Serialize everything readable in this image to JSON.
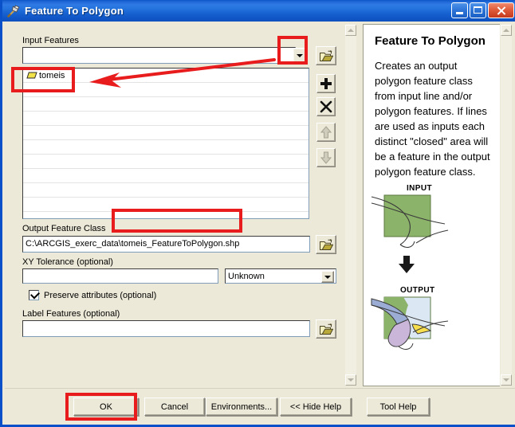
{
  "window": {
    "title": "Feature To Polygon",
    "icon": "hammer-tool-icon",
    "minimize_label": "Minimize",
    "maximize_label": "Maximize",
    "close_label": "Close"
  },
  "accent_colors": {
    "titlebar_blue": "#2f7ae4",
    "frame_blue": "#0a50c8",
    "dialog_face": "#ece9d8",
    "annotation_red": "#e81c1c",
    "polygon_green": "#8cb36a",
    "polygon_yellow": "#f2e24a"
  },
  "form": {
    "input_features": {
      "label": "Input Features",
      "value": "",
      "placeholder": "",
      "dropdown_icon": "chevron-down-icon",
      "browse_icon": "open-folder-icon"
    },
    "feature_list": {
      "items": [
        {
          "name": "tomeis",
          "icon": "polygon-layer-icon"
        }
      ],
      "empty_rows": 9
    },
    "list_tools": [
      {
        "name": "browse",
        "icon": "open-folder-icon",
        "enabled": true
      },
      {
        "name": "add",
        "icon": "plus-icon",
        "enabled": true
      },
      {
        "name": "remove",
        "icon": "x-icon",
        "enabled": true
      },
      {
        "name": "move-up",
        "icon": "arrow-up-icon",
        "enabled": false
      },
      {
        "name": "move-down",
        "icon": "arrow-down-icon",
        "enabled": false
      }
    ],
    "output_feature_class": {
      "label": "Output Feature Class",
      "value": "C:\\ARCGIS_exerc_data\\tomeis_FeatureToPolygon.shp",
      "browse_icon": "open-folder-icon"
    },
    "xy_tolerance": {
      "label": "XY Tolerance (optional)",
      "value": "",
      "units_selected": "Unknown",
      "units_icon": "chevron-down-icon"
    },
    "preserve_attributes": {
      "label": "Preserve attributes (optional)",
      "checked": true
    },
    "label_features": {
      "label": "Label Features (optional)",
      "value": "",
      "browse_icon": "open-folder-icon"
    }
  },
  "help": {
    "title": "Feature To Polygon",
    "body": "Creates an output polygon feature class from input line and/or polygon features. If lines are used as inputs each distinct \"closed\" area will be a feature in the output polygon feature class.",
    "diagram": {
      "input_label": "INPUT",
      "output_label": "OUTPUT",
      "flow_icon": "arrow-down-icon"
    }
  },
  "buttons": {
    "ok": "OK",
    "cancel": "Cancel",
    "environments": "Environments...",
    "hide_help": "<< Hide Help",
    "tool_help": "Tool Help"
  },
  "scrollbars": {
    "params_up_icon": "chevron-up-icon",
    "params_down_icon": "chevron-down-icon",
    "help_up_icon": "chevron-up-icon",
    "help_down_icon": "chevron-down-icon"
  },
  "annotations": [
    {
      "name": "highlight-dropdown-button",
      "shape": "rect"
    },
    {
      "name": "highlight-feature-list-item",
      "shape": "rect"
    },
    {
      "name": "pointer-to-feature-list-item",
      "shape": "arrow"
    },
    {
      "name": "highlight-output-filename",
      "shape": "rect"
    },
    {
      "name": "highlight-ok-button",
      "shape": "rect"
    }
  ]
}
